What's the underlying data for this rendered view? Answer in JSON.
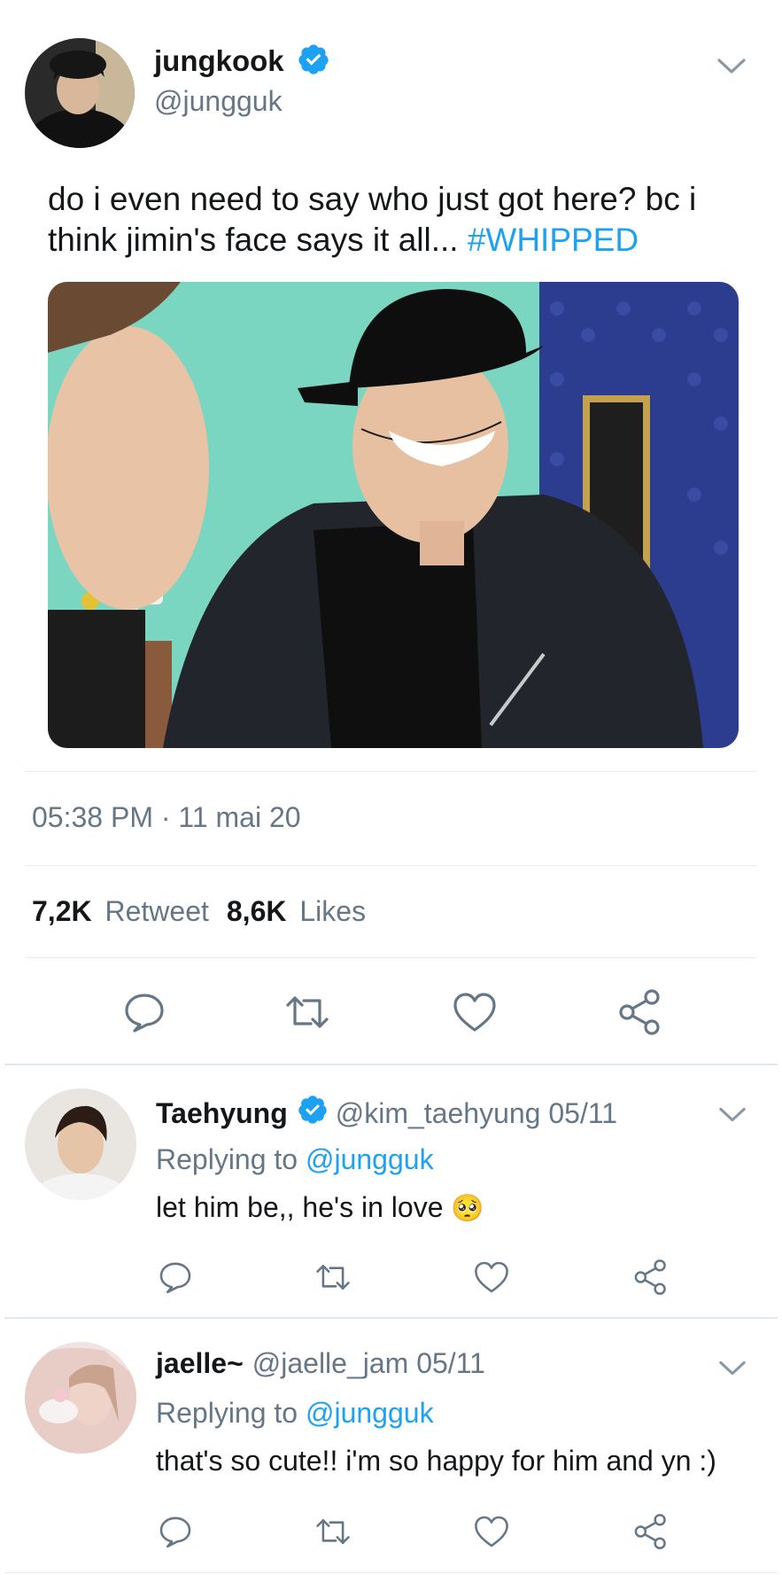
{
  "main_tweet": {
    "name": "jungkook",
    "handle": "@jungguk",
    "text_plain": "do i even need to say who just got here? bc i think jimin's face says it all... ",
    "hashtag": "#WHIPPED",
    "timestamp": "05:38 PM · 11 mai 20",
    "retweet_count": "7,2K",
    "retweet_label": "Retweet",
    "likes_count": "8,6K",
    "likes_label": "Likes"
  },
  "replies": [
    {
      "name": "Taehyung",
      "verified": true,
      "handle_date": "@kim_taehyung 05/11",
      "replying_prefix": "Replying to",
      "replying_handle": "@jungguk",
      "text": "let him be,, he's in love",
      "emoji": "🥺"
    },
    {
      "name": "jaelle~",
      "verified": false,
      "handle_date": "@jaelle_jam 05/11",
      "replying_prefix": "Replying to",
      "replying_handle": "@jungguk",
      "text": "that's so cute!! i'm so happy for him and yn :)",
      "emoji": ""
    }
  ],
  "icons": [
    "chevron-down-icon",
    "verified-badge-icon",
    "reply-icon",
    "retweet-icon",
    "like-icon",
    "share-icon"
  ],
  "colors": {
    "accent": "#1da1f2",
    "secondary_text": "#657786",
    "divider": "#e6ecf0"
  }
}
